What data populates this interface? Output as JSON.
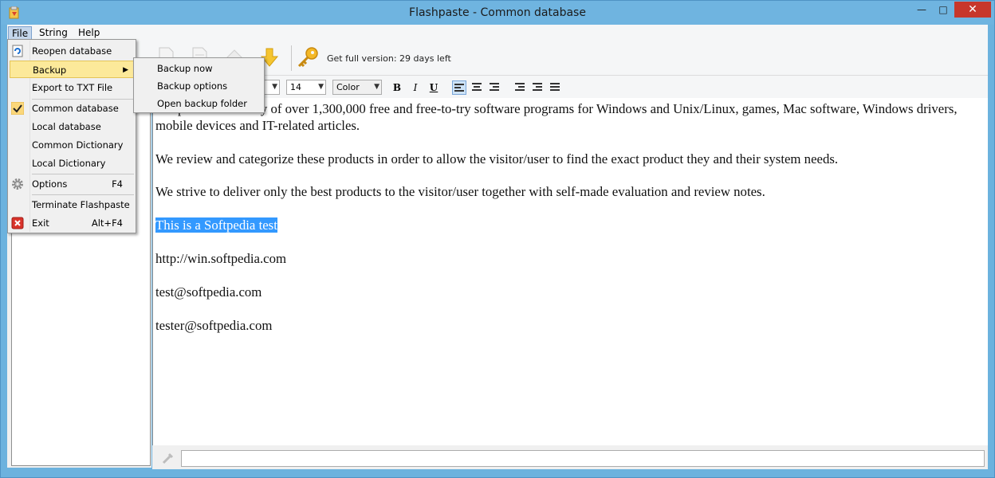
{
  "window": {
    "title": "Flashpaste - Common database"
  },
  "menubar": {
    "file": "File",
    "string": "String",
    "help": "Help"
  },
  "toolbar": {
    "promo": "Get full version: 29 days left"
  },
  "formatbar": {
    "font_size": "14",
    "color": "Color",
    "bold": "B",
    "italic": "I",
    "underline": "U"
  },
  "editor": {
    "paragraphs": [
      "Softpedia is a library of over 1,300,000 free and free-to-try software programs for Windows and Unix/Linux, games, Mac software, Windows drivers, mobile devices and IT-related articles.",
      "We review and categorize these products in order to allow the visitor/user to find the exact product they and their system needs.",
      "We strive to deliver only the best products to the visitor/user together with self-made evaluation and review notes."
    ],
    "selected_line": "This is a Softpedia test",
    "lines": [
      "http://win.softpedia.com",
      "test@softpedia.com",
      "tester@softpedia.com"
    ]
  },
  "file_menu": {
    "reopen": "Reopen database",
    "backup": "Backup",
    "export": "Export to TXT File",
    "common_db": "Common database",
    "local_db": "Local database",
    "common_dict": "Common Dictionary",
    "local_dict": "Local Dictionary",
    "options": "Options",
    "options_shortcut": "F4",
    "terminate": "Terminate Flashpaste",
    "exit": "Exit",
    "exit_shortcut": "Alt+F4"
  },
  "backup_submenu": {
    "now": "Backup now",
    "options": "Backup options",
    "open_folder": "Open backup folder"
  },
  "colors": {
    "selection": "#3399ff",
    "menu_hover": "#fce99a",
    "close_button": "#c7372b"
  }
}
